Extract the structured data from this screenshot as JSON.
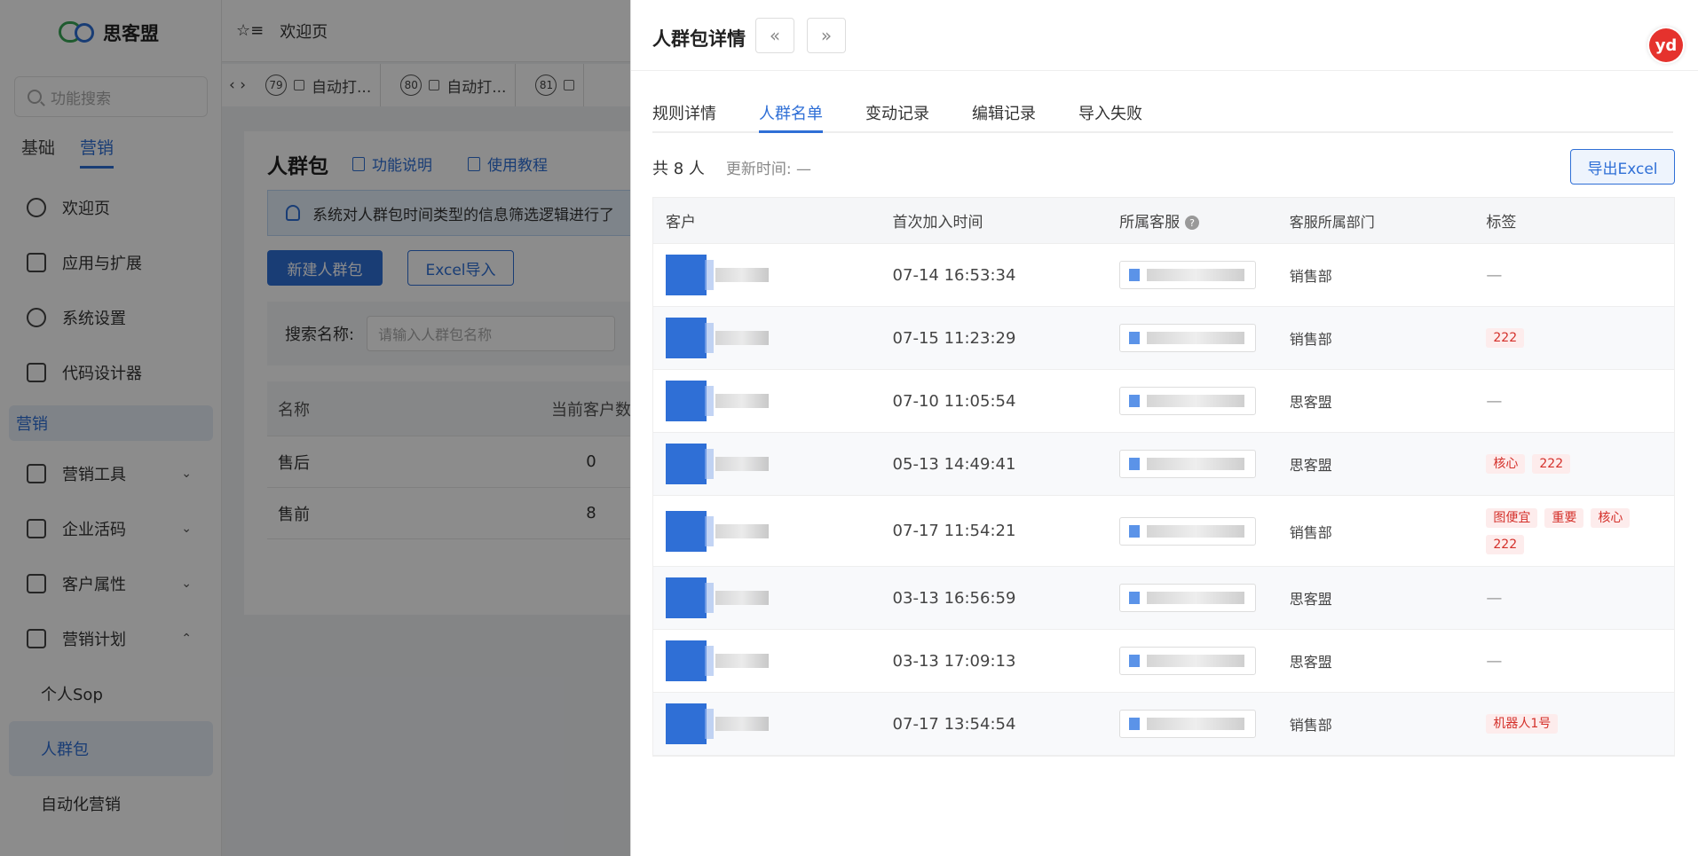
{
  "app": {
    "brand": "思客盟",
    "search_placeholder": "功能搜索",
    "side_tabs": [
      "基础",
      "营销"
    ],
    "menu": [
      {
        "label": "欢迎页",
        "icon": "home-icon"
      },
      {
        "label": "应用与扩展",
        "icon": "apps-icon"
      },
      {
        "label": "系统设置",
        "icon": "gear-icon"
      },
      {
        "label": "代码设计器",
        "icon": "code-icon"
      }
    ],
    "section": "营销",
    "marketing_menu": [
      {
        "label": "营销工具",
        "icon": "sliders-icon",
        "chevron": "⌄"
      },
      {
        "label": "企业活码",
        "icon": "qrcode-icon",
        "chevron": "⌄"
      },
      {
        "label": "客户属性",
        "icon": "properties-icon",
        "chevron": "⌄"
      },
      {
        "label": "营销计划",
        "icon": "chart-icon",
        "chevron": "⌃"
      }
    ],
    "sub_menu": [
      "个人Sop",
      "人群包",
      "自动化营销"
    ],
    "topbar": {
      "icon_left": "☆≡",
      "welcome": "欢迎页"
    },
    "tabs": [
      {
        "num": "79",
        "label": "自动打..."
      },
      {
        "num": "80",
        "label": "自动打..."
      },
      {
        "num": "81",
        "label": ""
      }
    ],
    "page": {
      "title": "人群包",
      "link1": "功能说明",
      "link2": "使用教程",
      "notice": "系统对人群包时间类型的信息筛选逻辑进行了",
      "btn_new": "新建人群包",
      "btn_import": "Excel导入",
      "search_label": "搜索名称:",
      "search_placeholder": "请输入人群包名称",
      "columns": [
        "名称",
        "当前客户数"
      ],
      "rows": [
        {
          "name": "售后",
          "count": "0"
        },
        {
          "name": "售前",
          "count": "8"
        }
      ]
    }
  },
  "drawer": {
    "title": "人群包详情",
    "prev": "«",
    "next": "»",
    "badge": "yd",
    "tabs": [
      "规则详情",
      "人群名单",
      "变动记录",
      "编辑记录",
      "导入失败"
    ],
    "active_tab": 1,
    "total": "共 8 人",
    "update_time": "更新时间: —",
    "export": "导出Excel",
    "columns": [
      "客户",
      "首次加入时间",
      "所属客服",
      "客服所属部门",
      "标签"
    ],
    "rows": [
      {
        "time": "07-14 16:53:34",
        "dept": "销售部",
        "tags": []
      },
      {
        "time": "07-15 11:23:29",
        "dept": "销售部",
        "tags": [
          "222"
        ]
      },
      {
        "time": "07-10 11:05:54",
        "dept": "思客盟",
        "tags": []
      },
      {
        "time": "05-13 14:49:41",
        "dept": "思客盟",
        "tags": [
          "核心",
          "222"
        ]
      },
      {
        "time": "07-17 11:54:21",
        "dept": "销售部",
        "tags": [
          "图便宜",
          "重要",
          "核心",
          "222"
        ]
      },
      {
        "time": "03-13 16:56:59",
        "dept": "思客盟",
        "tags": []
      },
      {
        "time": "03-13 17:09:13",
        "dept": "思客盟",
        "tags": []
      },
      {
        "time": "07-17 13:54:54",
        "dept": "销售部",
        "tags": [
          "机器人1号"
        ]
      }
    ],
    "empty": "—"
  }
}
